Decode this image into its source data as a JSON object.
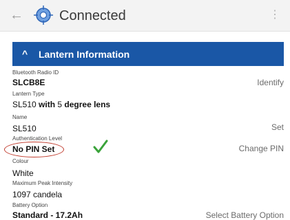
{
  "appbar": {
    "back_icon": "arrow-left-icon",
    "logo_icon": "lantern-target-logo",
    "title": "Connected",
    "menu_icon": "more-vertical-icon"
  },
  "section": {
    "chevron_icon": "chevron-up-icon",
    "title": "Lantern Information",
    "color": "#1a57a6"
  },
  "fields": {
    "radio_id": {
      "label": "Bluetooth Radio ID",
      "value": "SLCB8E",
      "action": "Identify"
    },
    "lantern_type": {
      "label": "Lantern Type",
      "value_a": "SL510",
      "value_b": " with ",
      "value_c": "5",
      "value_d": " degree lens"
    },
    "name": {
      "label": "Name",
      "value": "SL510",
      "action": "Set"
    },
    "auth": {
      "label": "Authentication Level",
      "value": "No PIN Set",
      "action": "Change PIN",
      "check_icon": "green-checkmark-icon",
      "highlight_color": "#c0392b",
      "check_color": "#3aa33a"
    },
    "colour": {
      "label": "Colour",
      "value": "White"
    },
    "intensity": {
      "label": "Maximum Peak Intensity",
      "value": "1097 candela"
    },
    "battery": {
      "label": "Battery Option",
      "value": "Standard - 17.2Ah",
      "action": "Select Battery Option"
    }
  }
}
